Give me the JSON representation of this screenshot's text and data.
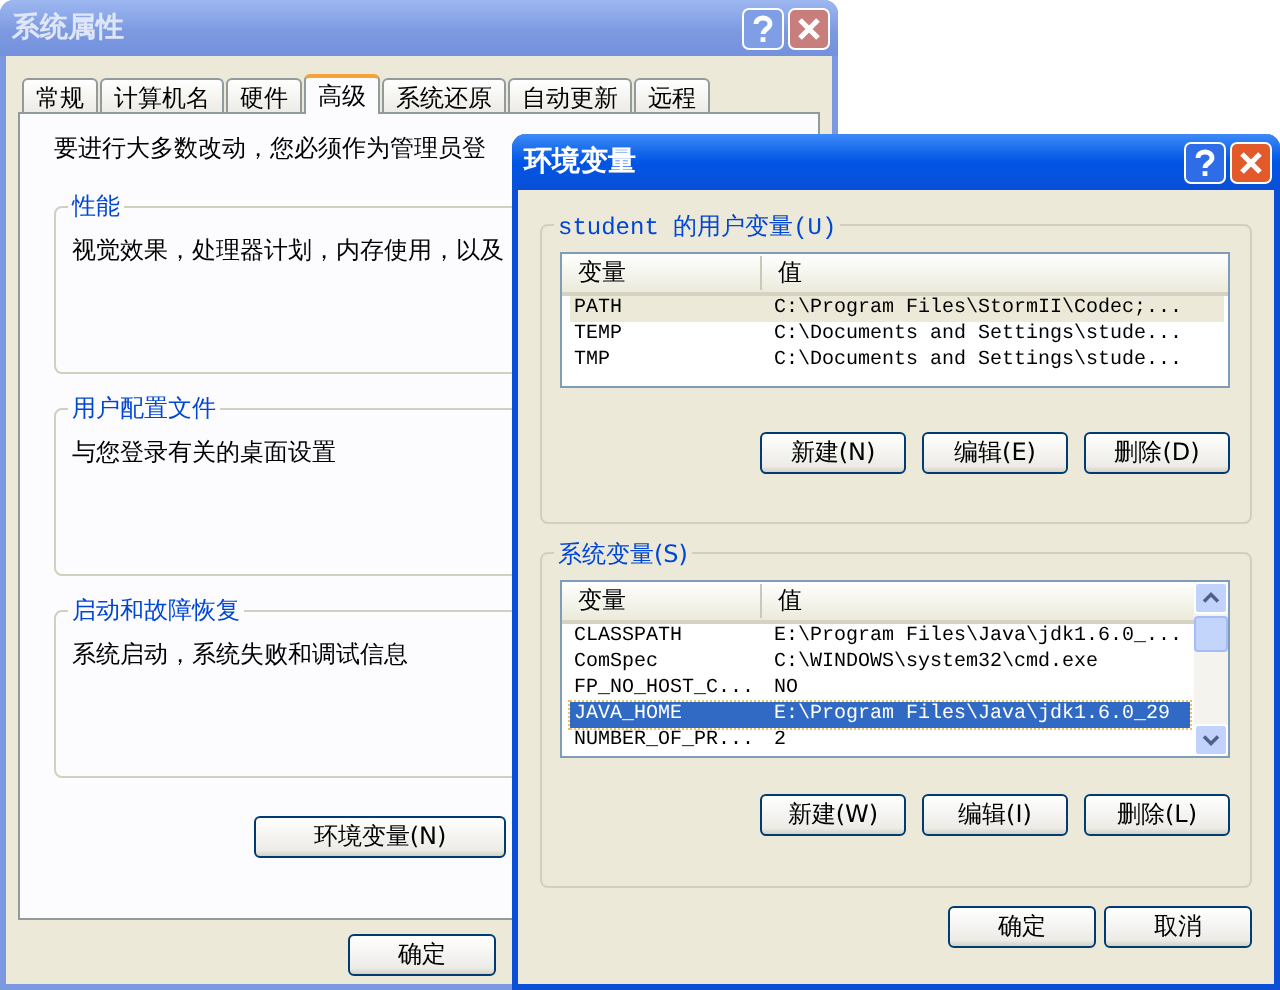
{
  "back_window": {
    "title": "系统属性",
    "tabs": [
      {
        "label": "常规",
        "selected": false
      },
      {
        "label": "计算机名",
        "selected": false
      },
      {
        "label": "硬件",
        "selected": false
      },
      {
        "label": "高级",
        "selected": true
      },
      {
        "label": "系统还原",
        "selected": false
      },
      {
        "label": "自动更新",
        "selected": false
      },
      {
        "label": "远程",
        "selected": false
      }
    ],
    "intro": "要进行大多数改动，您必须作为管理员登",
    "groups": [
      {
        "title": "性能",
        "description": "视觉效果，处理器计划，内存使用，以及"
      },
      {
        "title": "用户配置文件",
        "description": "与您登录有关的桌面设置"
      },
      {
        "title": "启动和故障恢复",
        "description": "系统启动，系统失败和调试信息"
      }
    ],
    "env_button": "环境变量(N)",
    "ok_button": "确定"
  },
  "front_window": {
    "title": "环境变量",
    "user_group": {
      "title": "student 的用户变量(U)",
      "columns": [
        "变量",
        "值"
      ],
      "rows": [
        {
          "name": "PATH",
          "value": "C:\\Program Files\\StormII\\Codec;...",
          "selected": true
        },
        {
          "name": "TEMP",
          "value": "C:\\Documents and Settings\\stude...",
          "selected": false
        },
        {
          "name": "TMP",
          "value": "C:\\Documents and Settings\\stude...",
          "selected": false
        }
      ],
      "buttons": [
        "新建(N)",
        "编辑(E)",
        "删除(D)"
      ]
    },
    "system_group": {
      "title": "系统变量(S)",
      "columns": [
        "变量",
        "值"
      ],
      "rows": [
        {
          "name": "CLASSPATH",
          "value": "E:\\Program Files\\Java\\jdk1.6.0_...",
          "selected": false
        },
        {
          "name": "ComSpec",
          "value": "C:\\WINDOWS\\system32\\cmd.exe",
          "selected": false
        },
        {
          "name": "FP_NO_HOST_C...",
          "value": "NO",
          "selected": false
        },
        {
          "name": "JAVA_HOME",
          "value": "E:\\Program Files\\Java\\jdk1.6.0_29",
          "selected": true
        },
        {
          "name": "NUMBER_OF_PR...",
          "value": "2",
          "selected": false
        }
      ],
      "buttons": [
        "新建(W)",
        "编辑(I)",
        "删除(L)"
      ]
    },
    "ok_button": "确定",
    "cancel_button": "取消"
  }
}
